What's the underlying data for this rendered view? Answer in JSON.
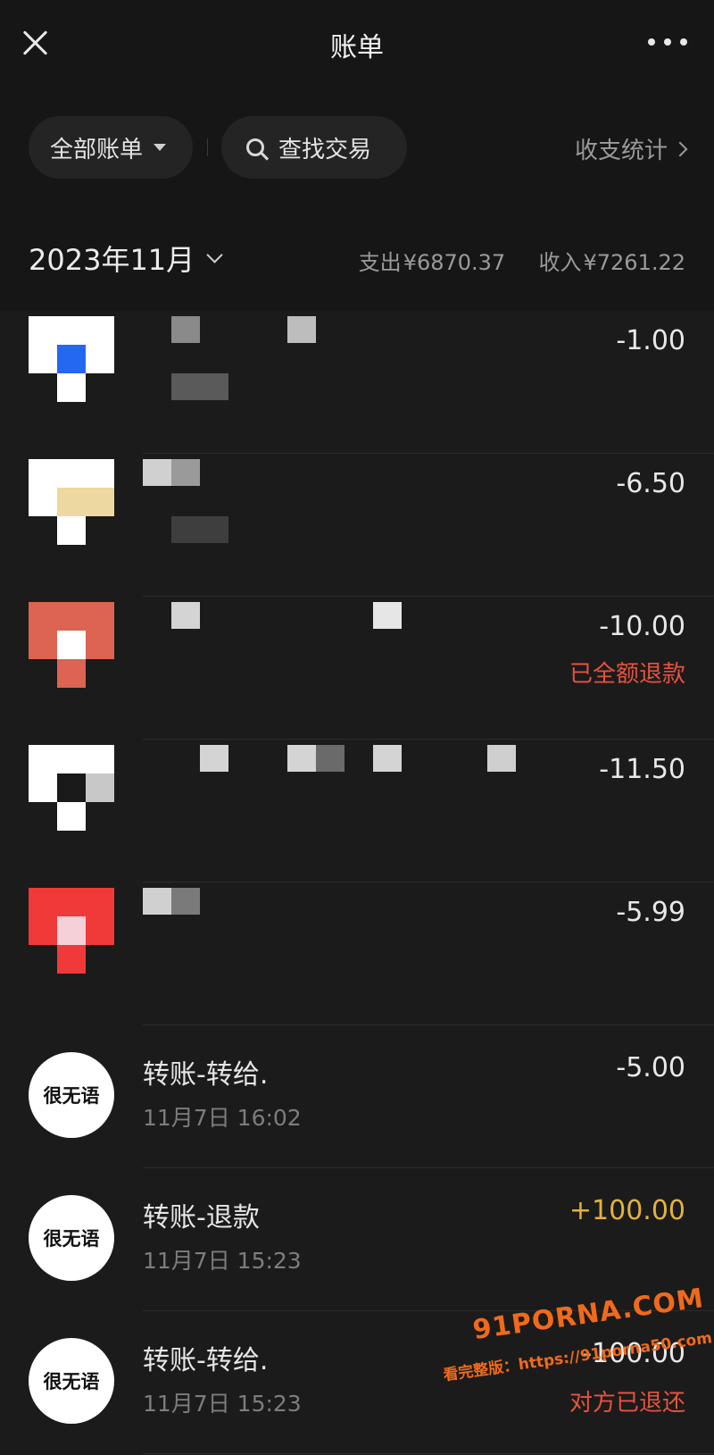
{
  "header": {
    "title": "账单",
    "close_icon": "close-icon",
    "more_icon": "more-icon"
  },
  "filters": {
    "all_bills": "全部账单",
    "search": "查找交易",
    "stats": "收支统计"
  },
  "month": {
    "label": "2023年11月",
    "expense_label": "支出",
    "expense": "¥6870.37",
    "income_label": "收入",
    "income": "¥7261.22"
  },
  "transactions": [
    {
      "amount": "-1.00",
      "status": ""
    },
    {
      "amount": "-6.50",
      "status": ""
    },
    {
      "amount": "-10.00",
      "status": "已全额退款"
    },
    {
      "amount": "-11.50",
      "status": ""
    },
    {
      "amount": "-5.99",
      "status": ""
    },
    {
      "avatar": "很无语",
      "title": "转账-转给.",
      "time": "11月7日 16:02",
      "amount": "-5.00",
      "status": ""
    },
    {
      "avatar": "很无语",
      "title": "转账-退款",
      "time": "11月7日 15:23",
      "amount": "+100.00",
      "status": ""
    },
    {
      "avatar": "很无语",
      "title": "转账-转给.",
      "time": "11月7日 15:23",
      "amount": "-100.00",
      "status": "对方已退还"
    }
  ],
  "watermark": {
    "brand": "91PORNA.COM",
    "line2": "看完整版：https://91porna50.com"
  },
  "colors": {
    "background": "#1b1b1b",
    "income": "#e2b23c",
    "refund": "#e5533f"
  }
}
